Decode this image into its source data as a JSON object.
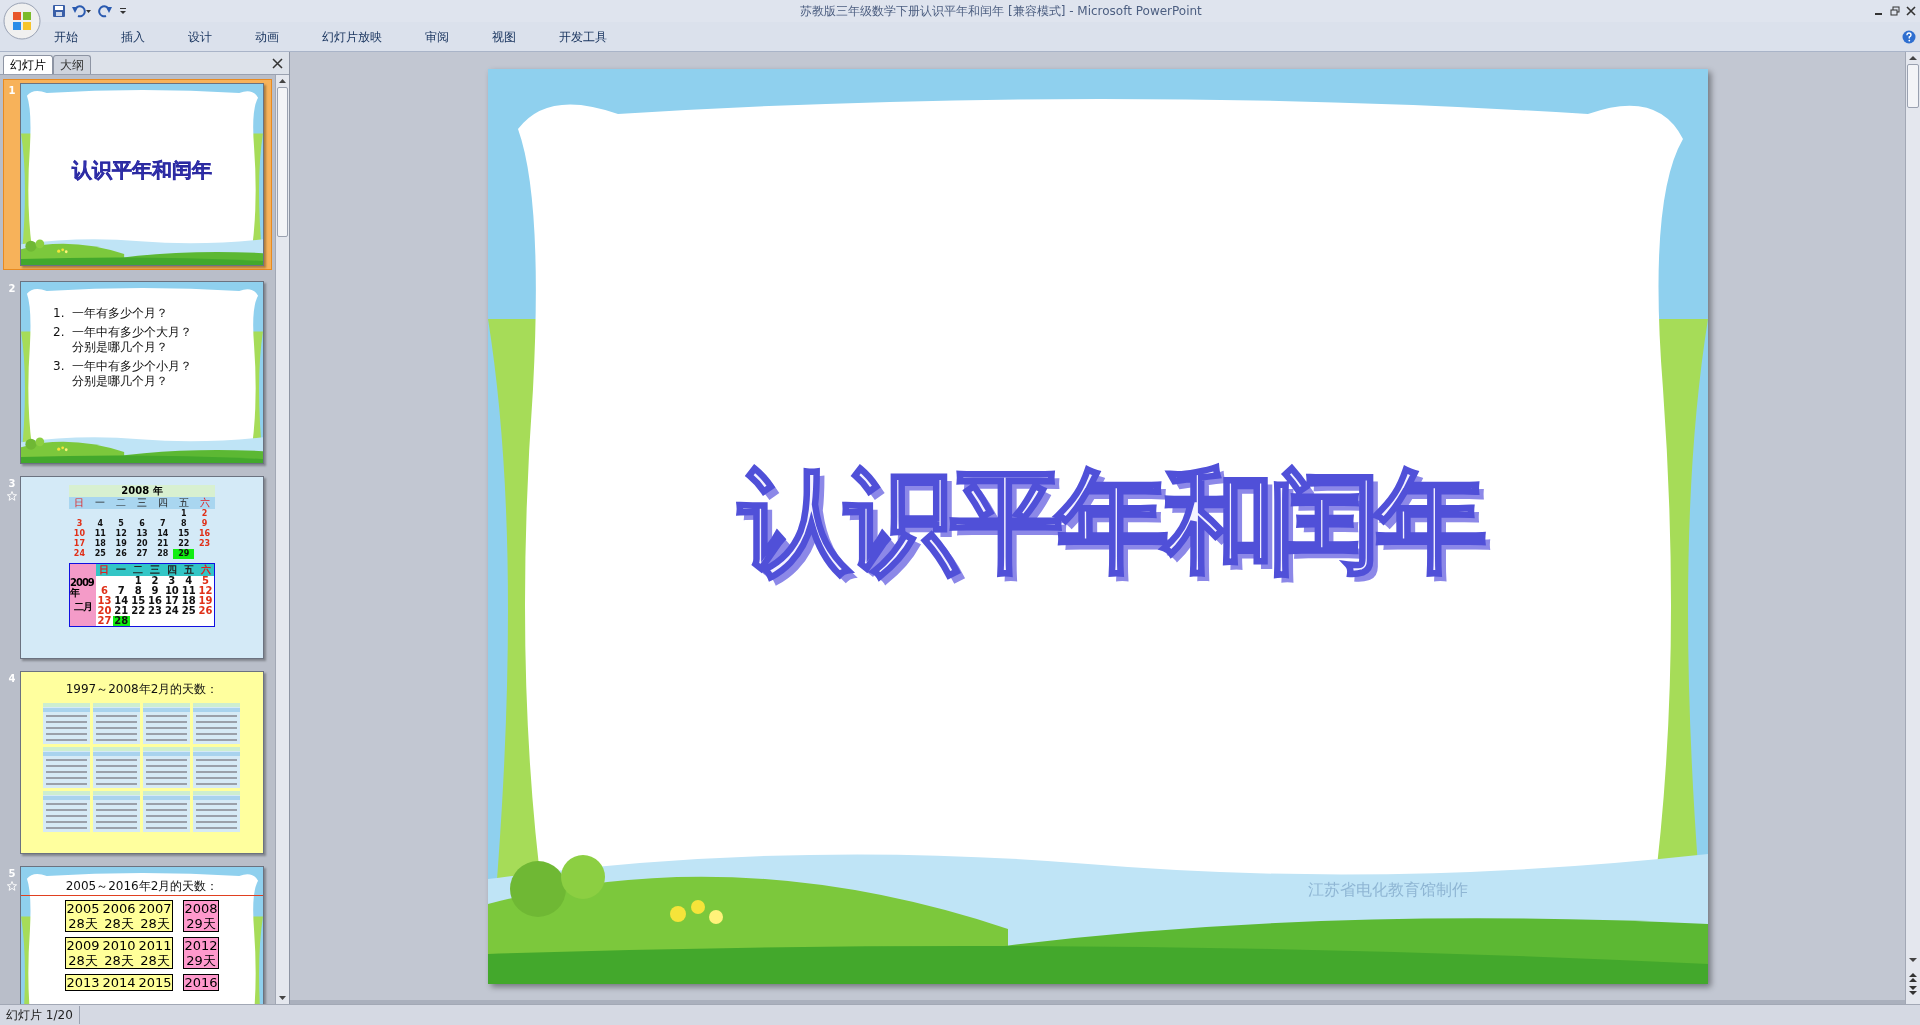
{
  "window": {
    "title": "苏教版三年级数学下册认识平年和闰年 [兼容模式] - Microsoft PowerPoint"
  },
  "ribbon_tabs": [
    {
      "label": "开始"
    },
    {
      "label": "插入"
    },
    {
      "label": "设计"
    },
    {
      "label": "动画"
    },
    {
      "label": "幻灯片放映"
    },
    {
      "label": "审阅"
    },
    {
      "label": "视图"
    },
    {
      "label": "开发工具"
    }
  ],
  "panel_tabs": [
    {
      "label": "幻灯片",
      "selected": true
    },
    {
      "label": "大纲",
      "selected": false
    }
  ],
  "slides": [
    {
      "number": "1",
      "kind": "title",
      "selected": true,
      "animated": false,
      "title": "认识平年和闰年"
    },
    {
      "number": "2",
      "kind": "questions",
      "selected": false,
      "animated": false,
      "items": [
        {
          "marker": "1.",
          "lines": [
            "一年有多少个月？"
          ]
        },
        {
          "marker": "2.",
          "lines": [
            "一年中有多少个大月？",
            "分别是哪几个月？"
          ]
        },
        {
          "marker": "3.",
          "lines": [
            "一年中有多少个小月？",
            "分别是哪几个月？"
          ]
        }
      ]
    },
    {
      "number": "3",
      "kind": "calendars",
      "selected": false,
      "animated": true,
      "calendars": [
        {
          "kind": "plain",
          "title": "2008 年",
          "weekdays": [
            "日",
            "一",
            "二",
            "三",
            "四",
            "五",
            "六"
          ],
          "weeks": [
            {
              "kind": "first",
              "days": [
                "1",
                "2"
              ],
              "last_marked": false
            },
            {
              "kind": "full",
              "days": [
                "3",
                "4",
                "5",
                "6",
                "7",
                "8",
                "9"
              ],
              "last_marked": false
            },
            {
              "kind": "full",
              "days": [
                "10",
                "11",
                "12",
                "13",
                "14",
                "15",
                "16"
              ],
              "last_marked": false
            },
            {
              "kind": "full",
              "days": [
                "17",
                "18",
                "19",
                "20",
                "21",
                "22",
                "23"
              ],
              "last_marked": false
            },
            {
              "kind": "last",
              "days": [
                "24",
                "25",
                "26",
                "27",
                "28",
                "29"
              ],
              "last_marked": true
            }
          ]
        },
        {
          "kind": "boxed",
          "side": [
            "2009年",
            "二月"
          ],
          "weekdays": [
            "日",
            "一",
            "二",
            "三",
            "四",
            "五",
            "六"
          ],
          "weeks": [
            {
              "kind": "first",
              "days": [
                "1",
                "2",
                "3",
                "4",
                "5"
              ],
              "last_marked": false
            },
            {
              "kind": "full",
              "days": [
                "6",
                "7",
                "8",
                "9",
                "10",
                "11",
                "12"
              ],
              "last_marked": false
            },
            {
              "kind": "full",
              "days": [
                "13",
                "14",
                "15",
                "16",
                "17",
                "18",
                "19"
              ],
              "last_marked": false
            },
            {
              "kind": "full",
              "days": [
                "20",
                "21",
                "22",
                "23",
                "24",
                "25",
                "26"
              ],
              "last_marked": false
            },
            {
              "kind": "last",
              "days": [
                "27",
                "28"
              ],
              "last_marked": true
            }
          ]
        }
      ]
    },
    {
      "number": "4",
      "kind": "calendar_grid",
      "selected": false,
      "animated": false,
      "title": "1997～2008年2月的天数："
    },
    {
      "number": "5",
      "kind": "day_counts",
      "selected": false,
      "animated": true,
      "title": "2005～2016年2月的天数：",
      "groups": [
        {
          "years": [
            {
              "year": "2005",
              "days": "28天"
            },
            {
              "year": "2006",
              "days": "28天"
            },
            {
              "year": "2007",
              "days": "28天"
            }
          ],
          "leap": {
            "year": "2008",
            "days": "29天"
          }
        },
        {
          "years": [
            {
              "year": "2009",
              "days": "28天"
            },
            {
              "year": "2010",
              "days": "28天"
            },
            {
              "year": "2011",
              "days": "28天"
            }
          ],
          "leap": {
            "year": "2012",
            "days": "29天"
          }
        },
        {
          "years": [
            {
              "year": "2013"
            },
            {
              "year": "2014"
            },
            {
              "year": "2015"
            }
          ],
          "leap": {
            "year": "2016"
          }
        }
      ]
    }
  ],
  "main_slide": {
    "title": "认识平年和闰年",
    "footer": "江苏省电化教育馆制作"
  },
  "status_bar": {
    "slide_indicator": "幻灯片 1/20"
  }
}
